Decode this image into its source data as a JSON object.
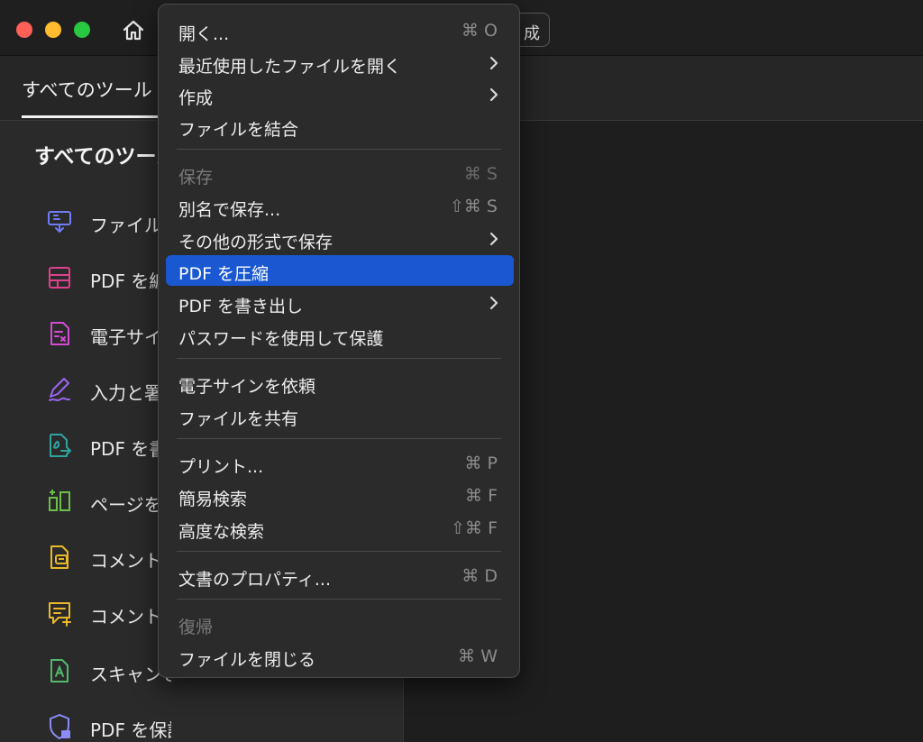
{
  "window": {
    "create_button_label": "成"
  },
  "tabs": {
    "all_tools": "すべてのツール"
  },
  "panel": {
    "title": "すべてのツール",
    "tools": [
      {
        "label": "ファイル",
        "icon": "file-convert-icon",
        "color": "#6f7cf7"
      },
      {
        "label": "PDF を編集",
        "icon": "edit-pdf-icon",
        "color": "#e0418c"
      },
      {
        "label": "電子サイン",
        "icon": "esign-icon",
        "color": "#d44bd4"
      },
      {
        "label": "入力と署名",
        "icon": "fill-sign-icon",
        "color": "#9a66f0"
      },
      {
        "label": "PDF を書き出し",
        "icon": "export-pdf-icon",
        "color": "#2fa5a0"
      },
      {
        "label": "ページを整理",
        "icon": "organize-pages-icon",
        "color": "#6cc04a"
      },
      {
        "label": "コメント",
        "icon": "comment-icon",
        "color": "#e9b92a"
      },
      {
        "label": "コメント",
        "icon": "comment-add-icon",
        "color": "#e9b92a"
      },
      {
        "label": "スキャンとOCR",
        "icon": "scan-ocr-icon",
        "color": "#52b86c"
      },
      {
        "label": "PDF を保護",
        "icon": "protect-pdf-icon",
        "color": "#8b8cf5"
      }
    ]
  },
  "menu": {
    "items": [
      {
        "label": "開く...",
        "shortcut": "⌘ O"
      },
      {
        "label": "最近使用したファイルを開く",
        "submenu": true
      },
      {
        "label": "作成",
        "submenu": true
      },
      {
        "label": "ファイルを結合"
      },
      {
        "label": "保存",
        "shortcut": "⌘ S",
        "disabled": true
      },
      {
        "label": "別名で保存...",
        "shortcut": "⇧⌘ S"
      },
      {
        "label": "その他の形式で保存",
        "submenu": true
      },
      {
        "label": "PDF を圧縮",
        "highlighted": true
      },
      {
        "label": "PDF を書き出し",
        "submenu": true
      },
      {
        "label": "パスワードを使用して保護"
      },
      {
        "label": "電子サインを依頼"
      },
      {
        "label": "ファイルを共有"
      },
      {
        "label": "プリント...",
        "shortcut": "⌘ P"
      },
      {
        "label": "簡易検索",
        "shortcut": "⌘ F"
      },
      {
        "label": "高度な検索",
        "shortcut": "⇧⌘ F"
      },
      {
        "label": "文書のプロパティ...",
        "shortcut": "⌘ D"
      },
      {
        "label": "復帰",
        "disabled": true
      },
      {
        "label": "ファイルを閉じる",
        "shortcut": "⌘ W"
      }
    ]
  },
  "colors": {
    "highlight": "#1a58d2",
    "menu_bg": "#2b2b2b"
  }
}
